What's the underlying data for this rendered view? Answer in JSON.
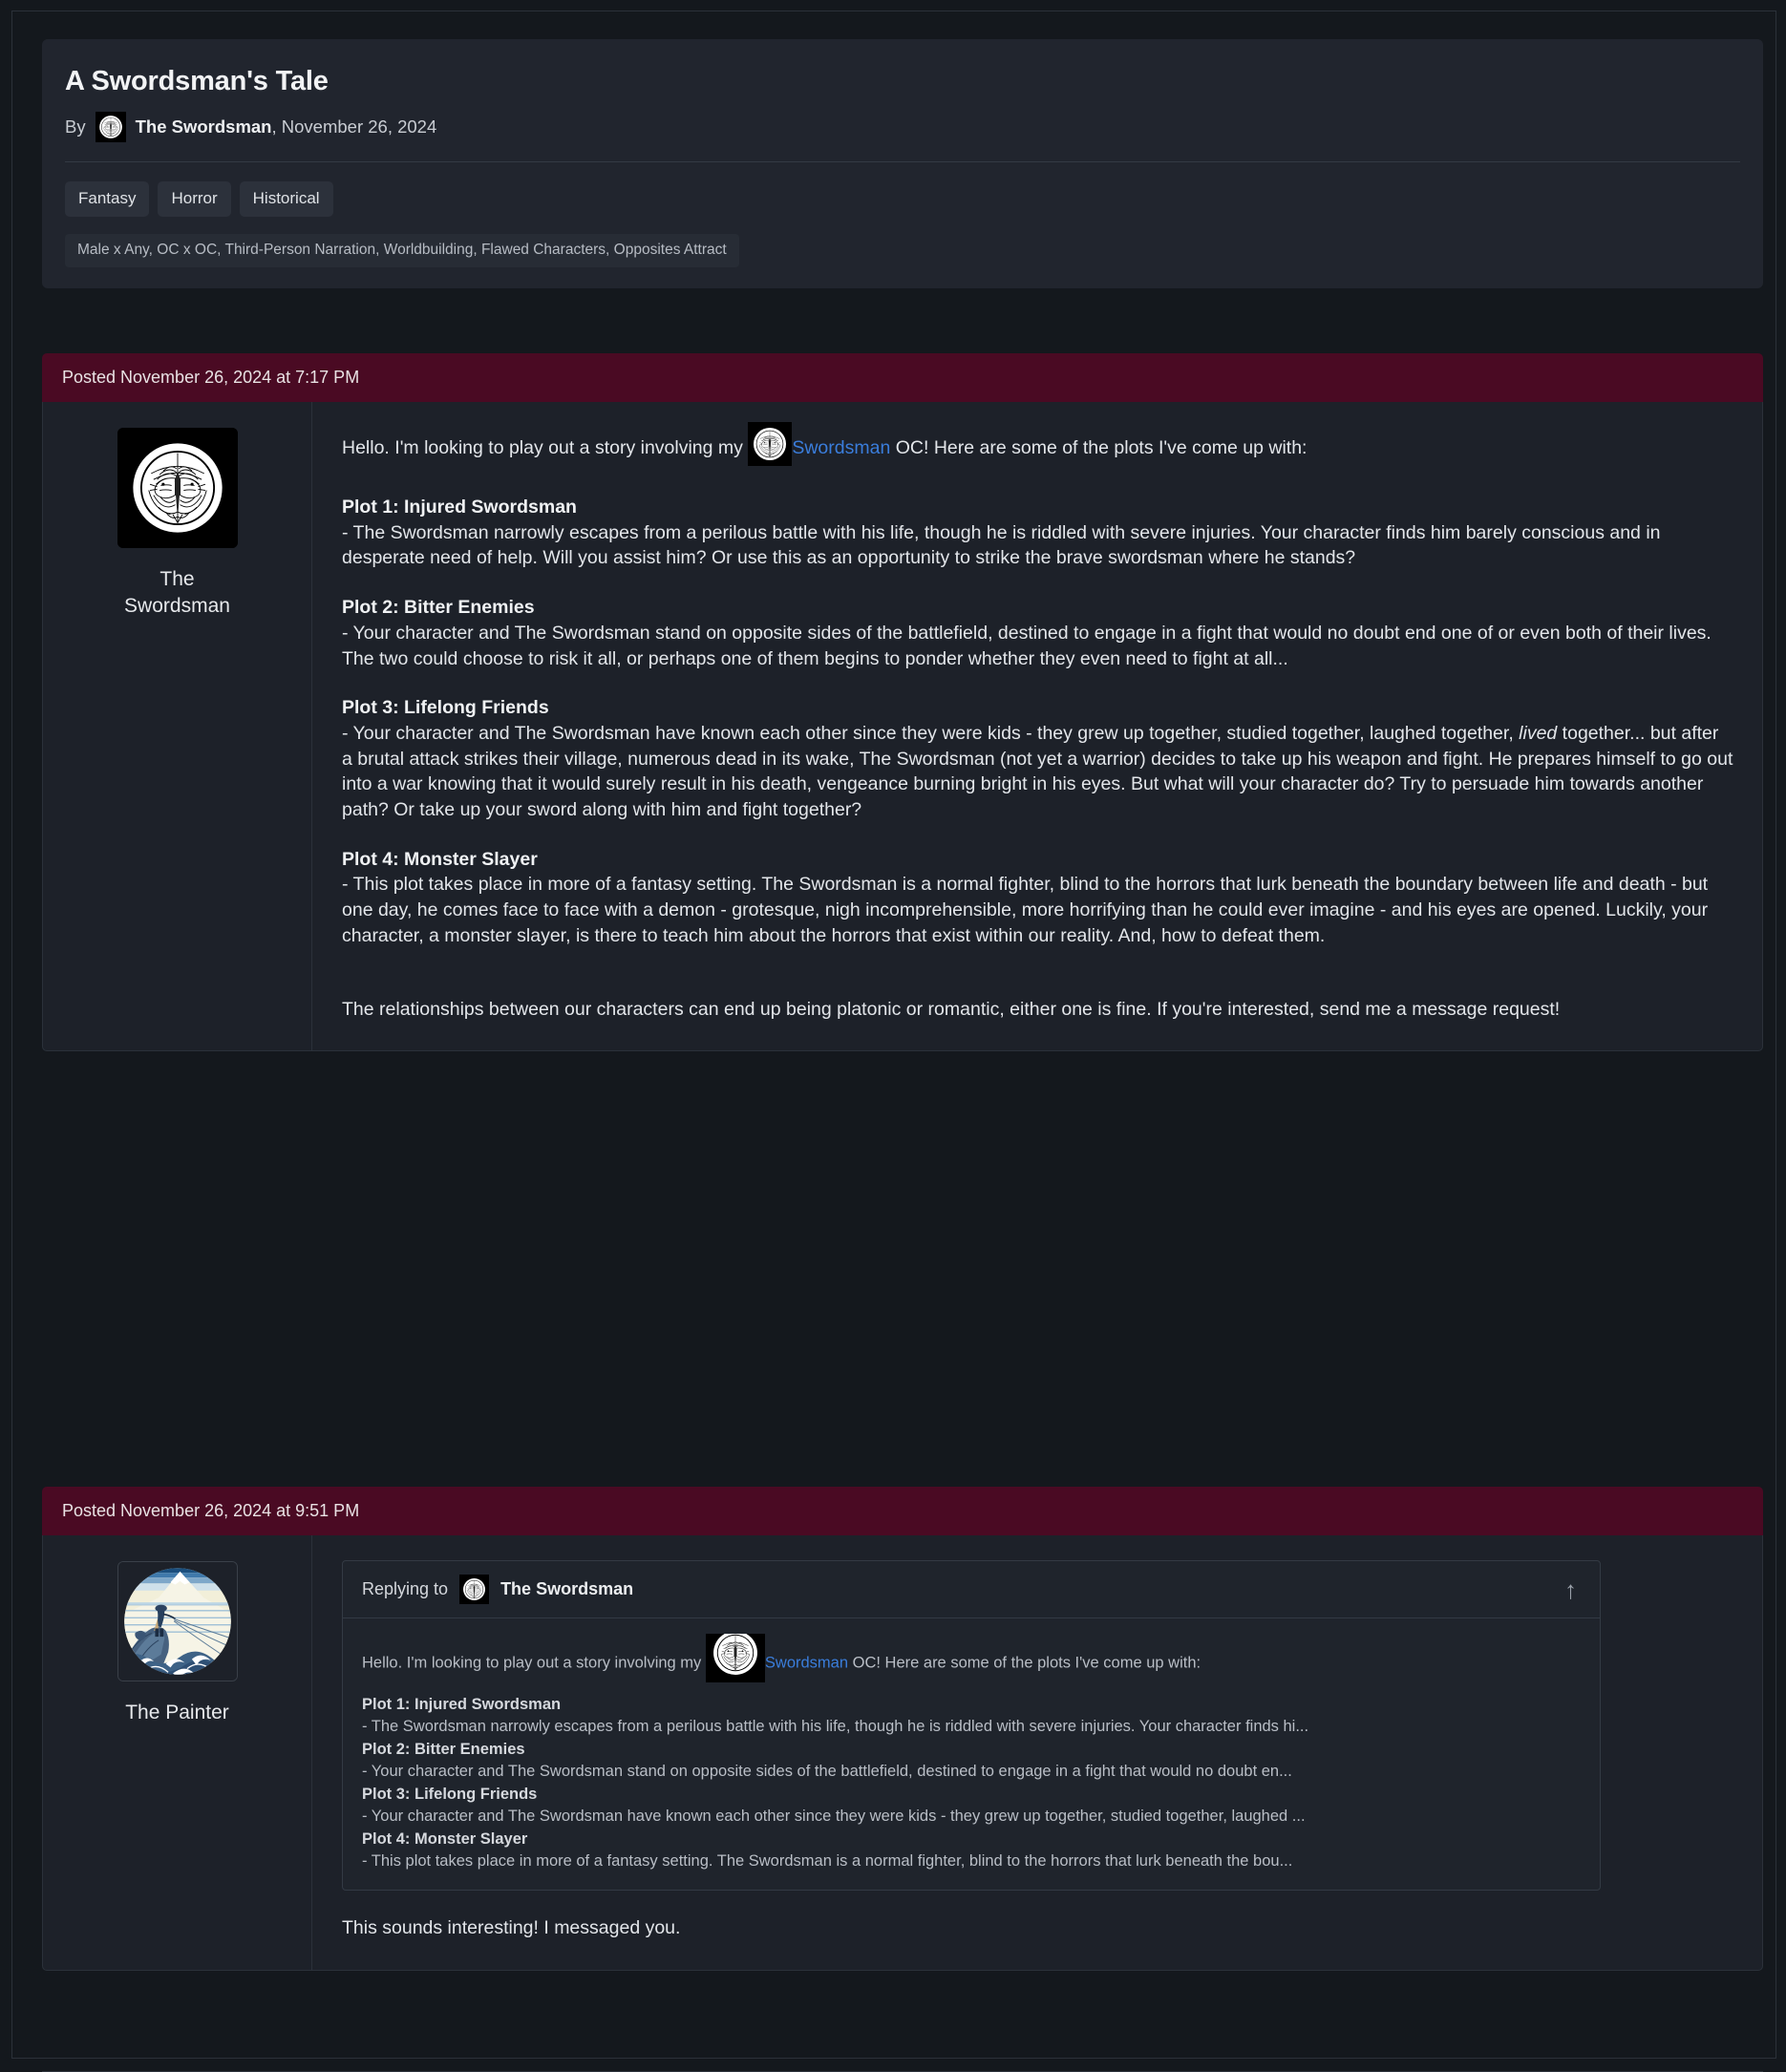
{
  "topic": {
    "title": "A Swordsman's Tale",
    "by_label": "By",
    "author": "The Swordsman",
    "date": ", November 26, 2024",
    "tags": [
      "Fantasy",
      "Horror",
      "Historical"
    ],
    "meta": "Male x Any, OC x OC, Third-Person Narration, Worldbuilding, Flawed Characters, Opposites Attract",
    "author_avatar_icon": "swordsman-kamon-avatar"
  },
  "posts": [
    {
      "posted_label": "Posted November 26, 2024 at 7:17 PM",
      "author": "The Swordsman",
      "avatar_icon": "swordsman-kamon-avatar",
      "intro_pre": "Hello. I'm looking to play out a story involving my",
      "intro_link": "Swordsman",
      "intro_post": "OC! Here are some of the plots I've come up with:",
      "plots": [
        {
          "title": "Plot 1: Injured Swordsman",
          "text": "- The Swordsman narrowly escapes from a perilous battle with his life, though he is riddled with severe injuries. Your character finds him barely conscious and in desperate need of help. Will you assist him? Or use this as an opportunity to strike the brave swordsman where he stands?"
        },
        {
          "title": "Plot 2: Bitter Enemies",
          "text": "- Your character and The Swordsman stand on opposite sides of the battlefield, destined to engage in a fight that would no doubt end one of or even both of their lives. The two could choose to risk it all, or perhaps one of them begins to ponder whether they even need to fight at all..."
        },
        {
          "title": "Plot 3: Lifelong Friends",
          "text_a": "- Your character and The Swordsman have known each other since they were kids - they grew up together, studied together, laughed together, ",
          "text_em": "lived",
          "text_b": " together... but after a brutal attack strikes their village, numerous dead in its wake, The Swordsman (not yet a warrior) decides to take up his weapon and fight. He prepares himself to go out into a war knowing that it would surely result in his death, vengeance burning bright in his eyes. But what will your character do? Try to persuade him towards another path? Or take up your sword along with him and fight together?"
        },
        {
          "title": "Plot 4: Monster Slayer",
          "text": "- This plot takes place in more of a fantasy setting. The Swordsman is a normal fighter, blind to the horrors that lurk beneath the boundary between life and death - but one day, he comes face to face with a demon - grotesque, nigh incomprehensible, more horrifying than he could ever imagine - and his eyes are opened. Luckily, your character, a monster slayer, is there to teach him about the horrors that exist within our reality. And, how to defeat them."
        }
      ],
      "closing": "The relationships between our characters can end up being platonic or romantic, either one is fine. If you're interested, send me a message request!"
    },
    {
      "posted_label": "Posted November 26, 2024 at 9:51 PM",
      "author": "The Painter",
      "avatar_icon": "painter-hokusai-avatar",
      "quote": {
        "replying_to_label": "Replying to",
        "quoted_author": "The Swordsman",
        "quoted_avatar_icon": "swordsman-kamon-avatar",
        "jump_icon": "arrow-up-icon",
        "first_pre": "Hello. I'm looking to play out a story involving my",
        "first_link": "Swordsman",
        "first_post": "OC! Here are some of the plots I've come up with:",
        "lines": [
          {
            "title": "Plot 1: Injured Swordsman",
            "snippet": "- The Swordsman narrowly escapes from a perilous battle with his life, though he is riddled with severe injuries. Your character finds hi..."
          },
          {
            "title": "Plot 2: Bitter Enemies",
            "snippet": "- Your character and The Swordsman stand on opposite sides of the battlefield, destined to engage in a fight that would no doubt en..."
          },
          {
            "title": "Plot 3: Lifelong Friends",
            "snippet": "- Your character and The Swordsman have known each other since they were kids - they grew up together, studied together, laughed ..."
          },
          {
            "title": "Plot 4: Monster Slayer",
            "snippet": "- This plot takes place in more of a fantasy setting. The Swordsman is a normal fighter, blind to the horrors that lurk beneath the bou..."
          }
        ]
      },
      "reply_text": "This sounds interesting! I messaged you."
    }
  ],
  "colors": {
    "page_background": "#14181d",
    "card_background": "#21252e",
    "post_background": "#1d2129",
    "post_header_background": "#4a0a23",
    "link_accent": "#3a7ddb",
    "text_primary": "#e3e6ea",
    "text_muted": "#b7bcc4"
  }
}
